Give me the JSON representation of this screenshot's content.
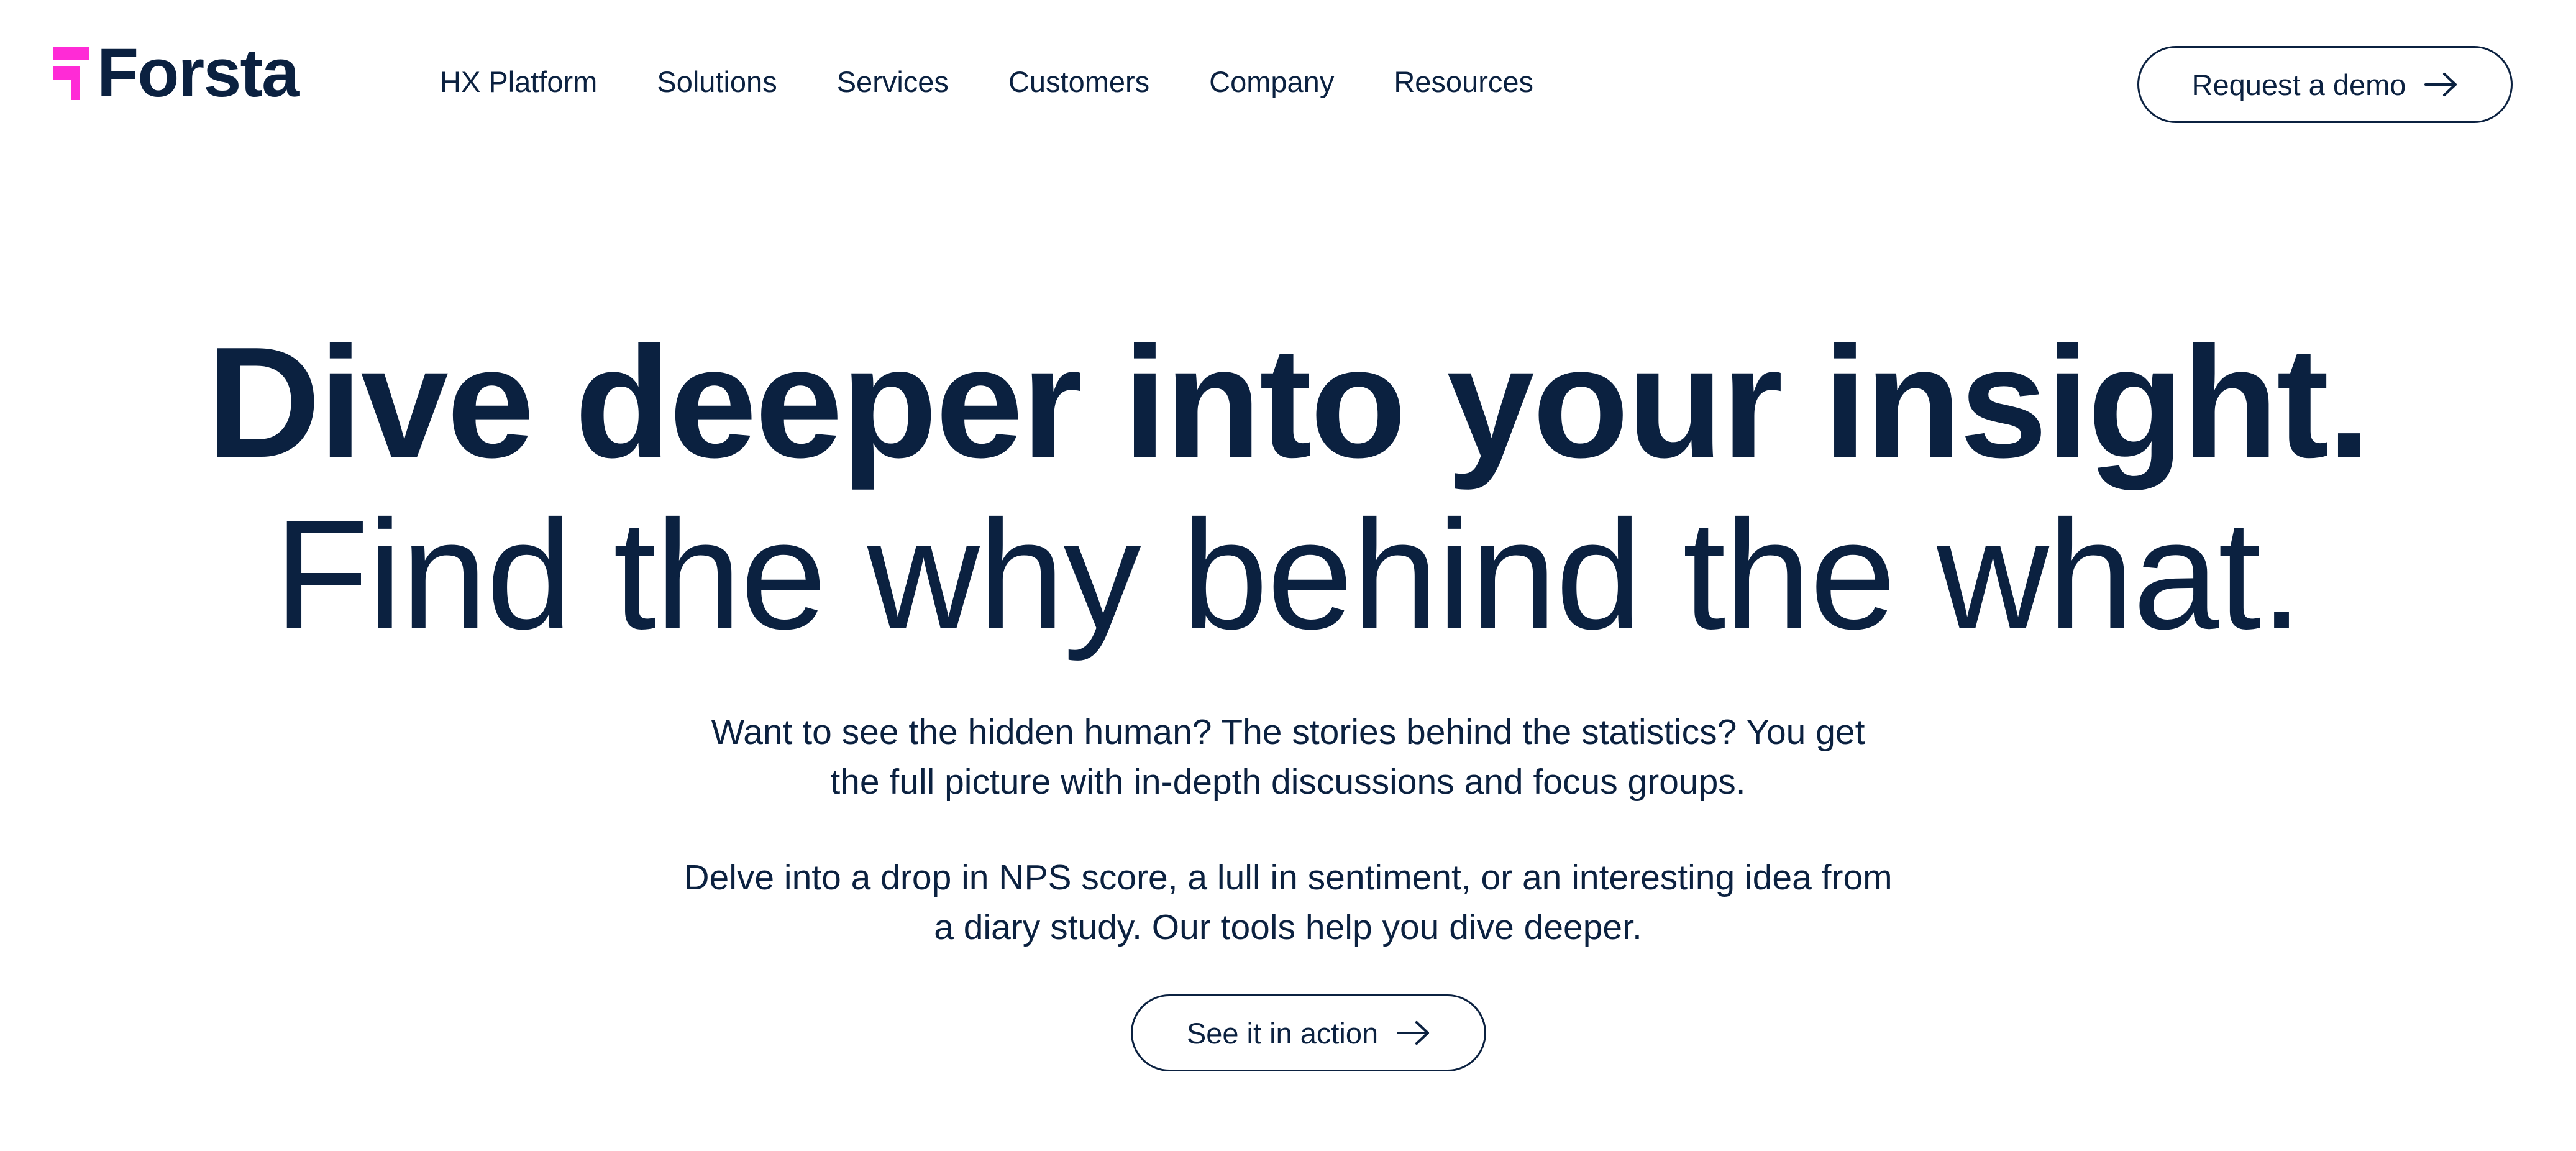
{
  "brand": {
    "name": "Forsta",
    "accent_color": "#ff2bd6",
    "text_color": "#0b2140"
  },
  "nav": {
    "items": [
      "HX Platform",
      "Solutions",
      "Services",
      "Customers",
      "Company",
      "Resources"
    ]
  },
  "header": {
    "cta_label": "Request a demo",
    "cta_icon": "arrow-right-icon"
  },
  "hero": {
    "title": "Dive deeper into your insight.",
    "subtitle": "Find the why behind the what.",
    "paragraph1": {
      "line1": "Want to see the hidden human? The stories behind the statistics? You get",
      "line2": "the full picture with in-depth discussions and focus groups."
    },
    "paragraph2": {
      "line1": "Delve into a drop in NPS score, a lull in sentiment, or an interesting idea from",
      "line2": "a diary study. Our tools help you dive deeper."
    },
    "cta_label": "See it in action",
    "cta_icon": "arrow-right-icon"
  }
}
